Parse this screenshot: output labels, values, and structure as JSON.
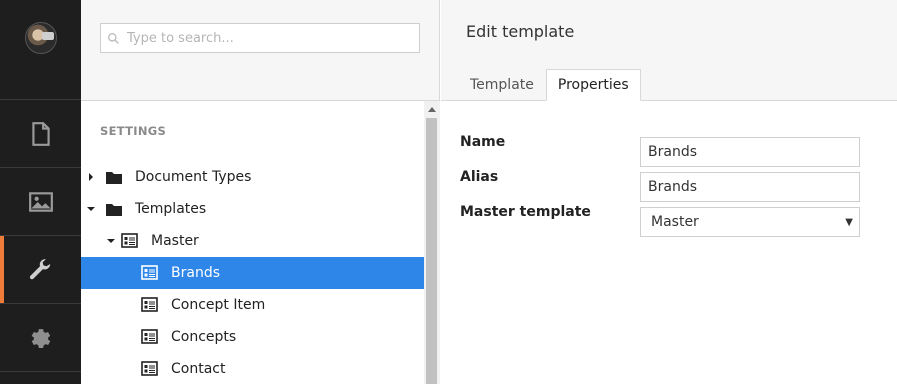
{
  "rail": {
    "items": [
      {
        "name": "content",
        "icon": "document-icon",
        "active": false
      },
      {
        "name": "media",
        "icon": "image-icon",
        "active": false
      },
      {
        "name": "settings",
        "icon": "wrench-icon",
        "active": true
      },
      {
        "name": "developer",
        "icon": "gear-icon",
        "active": false
      }
    ],
    "accent": "#f07c3a"
  },
  "search": {
    "placeholder": "Type to search..."
  },
  "tree": {
    "section_label": "SETTINGS",
    "nodes": [
      {
        "label": "Document Types",
        "icon": "folder-icon",
        "expanded": false
      },
      {
        "label": "Templates",
        "icon": "folder-icon",
        "expanded": true
      },
      {
        "label": "Master",
        "icon": "template-icon",
        "expanded": true
      },
      {
        "label": "Brands",
        "icon": "template-icon",
        "selected": true
      },
      {
        "label": "Concept Item",
        "icon": "template-icon"
      },
      {
        "label": "Concepts",
        "icon": "template-icon"
      },
      {
        "label": "Contact",
        "icon": "template-icon"
      }
    ],
    "selected_color": "#2e87e8"
  },
  "editor": {
    "title": "Edit template",
    "tabs": [
      {
        "label": "Template",
        "active": false
      },
      {
        "label": "Properties",
        "active": true
      }
    ],
    "fields": {
      "name_label": "Name",
      "name_value": "Brands",
      "alias_label": "Alias",
      "alias_value": "Brands",
      "master_label": "Master template",
      "master_value": "Master"
    }
  }
}
